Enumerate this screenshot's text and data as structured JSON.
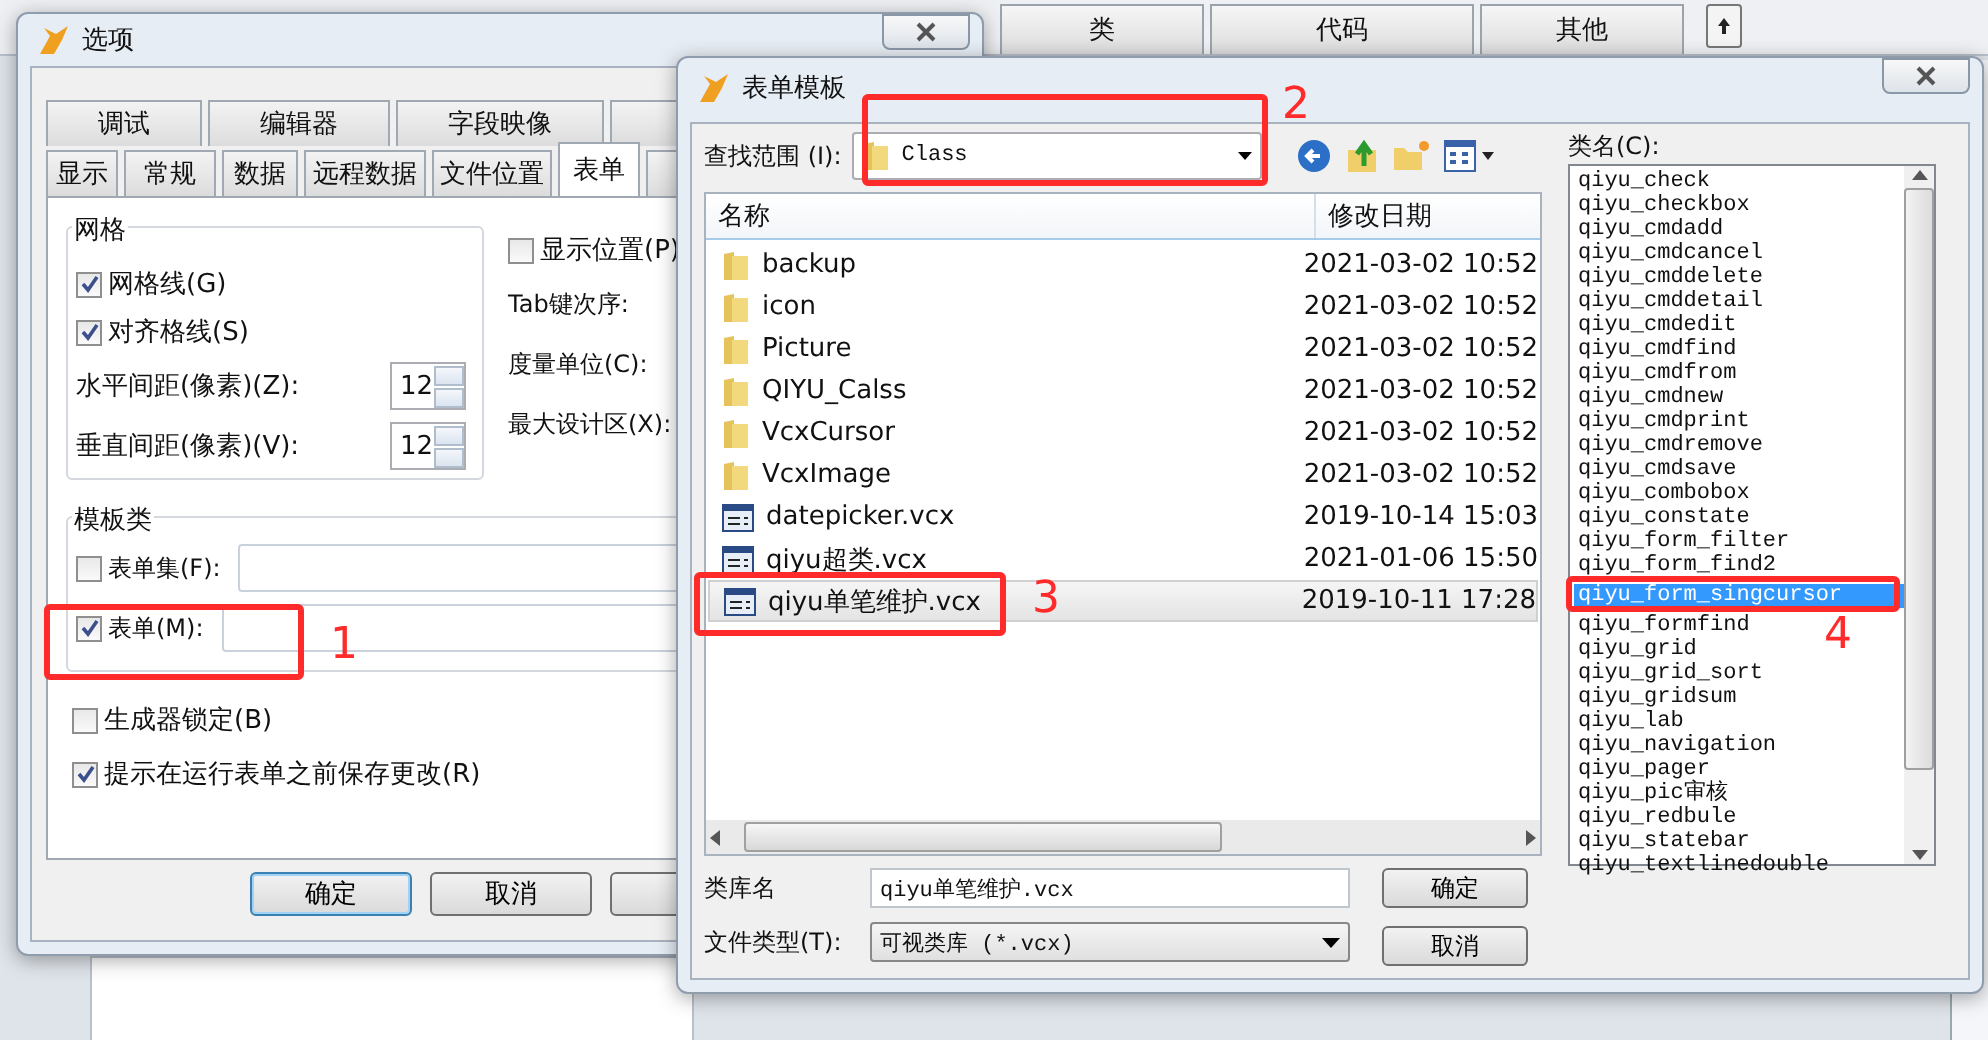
{
  "background_window": {
    "tabs": [
      {
        "label": "类"
      },
      {
        "label": "代码"
      },
      {
        "label": "其他"
      }
    ]
  },
  "options_window": {
    "title": "选项",
    "tab_rows": [
      [
        {
          "label": "调试",
          "selected": false
        },
        {
          "label": "编辑器",
          "selected": false
        },
        {
          "label": "字段映像",
          "selected": false
        }
      ],
      [
        {
          "label": "显示",
          "selected": false
        },
        {
          "label": "常规",
          "selected": false
        },
        {
          "label": "数据",
          "selected": false
        },
        {
          "label": "远程数据",
          "selected": false
        },
        {
          "label": "文件位置",
          "selected": false
        },
        {
          "label": "表单",
          "selected": true
        }
      ]
    ],
    "grid_group": {
      "title": "网格",
      "checkboxes": [
        {
          "label": "网格线(G)",
          "checked": true
        },
        {
          "label": "对齐格线(S)",
          "checked": true
        }
      ],
      "spinners": [
        {
          "label": "水平间距(像素)(Z):",
          "value": "12"
        },
        {
          "label": "垂直间距(像素)(V):",
          "value": "12"
        }
      ]
    },
    "show_position": {
      "label": "显示位置(P)",
      "checked": false
    },
    "right_labels": [
      "Tab键次序:",
      "度量单位(C):",
      "最大设计区(X):"
    ],
    "template_group": {
      "title": "模板类",
      "rows": [
        {
          "label": "表单集(F):",
          "checked": false
        },
        {
          "label": "表单(M):",
          "checked": true
        }
      ]
    },
    "checkboxes": [
      {
        "label": "生成器锁定(B)",
        "checked": false
      },
      {
        "label": "提示在运行表单之前保存更改(R)",
        "checked": true
      }
    ],
    "buttons": [
      {
        "label": "确定",
        "default": true
      },
      {
        "label": "取消",
        "default": false
      }
    ]
  },
  "template_window": {
    "title": "表单模板",
    "look_in_label": "查找范围 (I):",
    "look_in_value": "Class",
    "columns": [
      "名称",
      "修改日期"
    ],
    "files": [
      {
        "name": "backup",
        "date": "2021-03-02 10:52",
        "kind": "folder",
        "selected": false
      },
      {
        "name": "icon",
        "date": "2021-03-02 10:52",
        "kind": "folder",
        "selected": false
      },
      {
        "name": "Picture",
        "date": "2021-03-02 10:52",
        "kind": "folder",
        "selected": false
      },
      {
        "name": "QIYU_Calss",
        "date": "2021-03-02 10:52",
        "kind": "folder",
        "selected": false
      },
      {
        "name": "VcxCursor",
        "date": "2021-03-02 10:52",
        "kind": "folder",
        "selected": false
      },
      {
        "name": "VcxImage",
        "date": "2021-03-02 10:52",
        "kind": "folder",
        "selected": false
      },
      {
        "name": "datepicker.vcx",
        "date": "2019-10-14 15:03",
        "kind": "library",
        "selected": false
      },
      {
        "name": "qiyu超类.vcx",
        "date": "2021-01-06 15:50",
        "kind": "library",
        "selected": false
      },
      {
        "name": "qiyu单笔维护.vcx",
        "date": "2019-10-11 17:28",
        "kind": "library",
        "selected": true
      }
    ],
    "library_label": "类库名",
    "library_value": "qiyu单笔维护.vcx",
    "type_label": "文件类型(T):",
    "type_value": "可视类库 (*.vcx)",
    "buttons": [
      "确定",
      "取消"
    ],
    "class_label": "类名(C):",
    "classes": [
      {
        "name": "qiyu_check",
        "selected": false
      },
      {
        "name": "qiyu_checkbox",
        "selected": false
      },
      {
        "name": "qiyu_cmdadd",
        "selected": false
      },
      {
        "name": "qiyu_cmdcancel",
        "selected": false
      },
      {
        "name": "qiyu_cmddelete",
        "selected": false
      },
      {
        "name": "qiyu_cmddetail",
        "selected": false
      },
      {
        "name": "qiyu_cmdedit",
        "selected": false
      },
      {
        "name": "qiyu_cmdfind",
        "selected": false
      },
      {
        "name": "qiyu_cmdfrom",
        "selected": false
      },
      {
        "name": "qiyu_cmdnew",
        "selected": false
      },
      {
        "name": "qiyu_cmdprint",
        "selected": false
      },
      {
        "name": "qiyu_cmdremove",
        "selected": false
      },
      {
        "name": "qiyu_cmdsave",
        "selected": false
      },
      {
        "name": "qiyu_combobox",
        "selected": false
      },
      {
        "name": "qiyu_constate",
        "selected": false
      },
      {
        "name": "qiyu_form_filter",
        "selected": false
      },
      {
        "name": "qiyu_form_find2",
        "selected": false
      },
      {
        "name": "qiyu_form_singcursor",
        "selected": true
      },
      {
        "name": "qiyu_formfind",
        "selected": false
      },
      {
        "name": "qiyu_grid",
        "selected": false
      },
      {
        "name": "qiyu_grid_sort",
        "selected": false
      },
      {
        "name": "qiyu_gridsum",
        "selected": false
      },
      {
        "name": "qiyu_lab",
        "selected": false
      },
      {
        "name": "qiyu_navigation",
        "selected": false
      },
      {
        "name": "qiyu_pager",
        "selected": false
      },
      {
        "name": "qiyu_pic审核",
        "selected": false
      },
      {
        "name": "qiyu_redbule",
        "selected": false
      },
      {
        "name": "qiyu_statebar",
        "selected": false
      },
      {
        "name": "qiyu_textlinedouble",
        "selected": false
      }
    ]
  },
  "annotations": [
    {
      "number": "1"
    },
    {
      "number": "2"
    },
    {
      "number": "3"
    },
    {
      "number": "4"
    }
  ]
}
